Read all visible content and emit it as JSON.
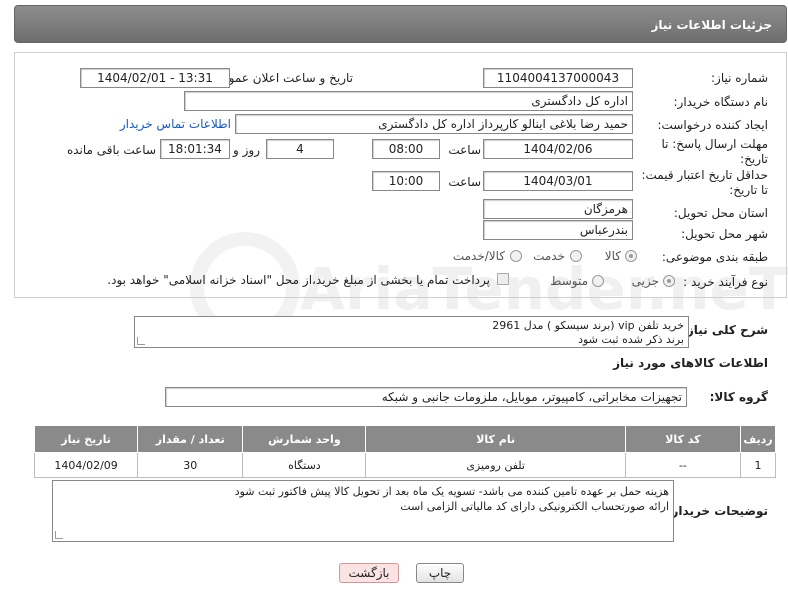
{
  "header": {
    "title": "جزئیات اطلاعات نیاز"
  },
  "form": {
    "need_number_label": "شماره نیاز:",
    "need_number": "1104004137000043",
    "announce_label": "تاریخ و ساعت اعلان عمومی:",
    "announce_value": "1404/02/01 - 13:31",
    "buyer_org_label": "نام دستگاه خریدار:",
    "buyer_org": "اداره کل دادگستری",
    "creator_label": "ایجاد کننده درخواست:",
    "creator": "حمید رضا  بلاغی اینالو کارپرداز اداره کل دادگستری",
    "contact_link": "اطلاعات تماس خریدار",
    "deadline_label_1": "مهلت ارسال پاسخ: تا",
    "deadline_label_2": "تاریخ:",
    "deadline_date": "1404/02/06",
    "time_word": "ساعت",
    "deadline_time": "08:00",
    "days_value": "4",
    "days_word": "روز و",
    "remaining_time": "18:01:34",
    "remaining_word": "ساعت باقی مانده",
    "validity_label_1": "حداقل تاریخ اعتبار قیمت:",
    "validity_label_2": "تا تاریخ:",
    "validity_date": "1404/03/01",
    "validity_time": "10:00",
    "province_label": "استان محل تحویل:",
    "province": "هرمزگان",
    "city_label": "شهر محل تحویل:",
    "city": "بندرعباس",
    "category_label": "طبقه بندی موضوعی:",
    "category_options": [
      "کالا",
      "خدمت",
      "کالا/خدمت"
    ],
    "category_selected": "کالا",
    "process_label": "نوع فرآیند خرید :",
    "process_options": [
      "جزیی",
      "متوسط"
    ],
    "process_selected": "جزیی",
    "payment_note": "پرداخت تمام یا بخشی از مبلغ خرید،از محل \"اسناد خزانه اسلامی\" خواهد بود."
  },
  "description": {
    "label": "شرح کلی نیاز:",
    "line1": "خرید تلفن vip  (برند سیسکو ) مدل 2961",
    "line2": "برند ذکر شده ثبت شود"
  },
  "goods_info": {
    "title": "اطلاعات کالاهای مورد نیاز",
    "group_label": "گروه کالا:",
    "group_value": "تجهیزات مخابراتی، کامپیوتر، موبایل، ملزومات جانبی و شبکه"
  },
  "table": {
    "headers": [
      "ردیف",
      "کد کالا",
      "نام کالا",
      "واحد شمارش",
      "تعداد / مقدار",
      "تاریخ نیاز"
    ],
    "rows": [
      [
        "1",
        "--",
        "تلفن رومیزی",
        "دستگاه",
        "30",
        "1404/02/09"
      ]
    ]
  },
  "buyer_notes": {
    "label": "توضیحات خریدار:",
    "line1": "هزینه حمل بر عهده تامین کننده می باشد- تسویه یک ماه بعد از تحویل کالا پیش فاکتور ثبت شود",
    "line2": "ارائه صورتحساب الکترونیکی دارای کد مالیاتی الزامی است"
  },
  "buttons": {
    "print": "چاپ",
    "back": "بازگشت"
  },
  "watermark": "AriaTender.neT"
}
